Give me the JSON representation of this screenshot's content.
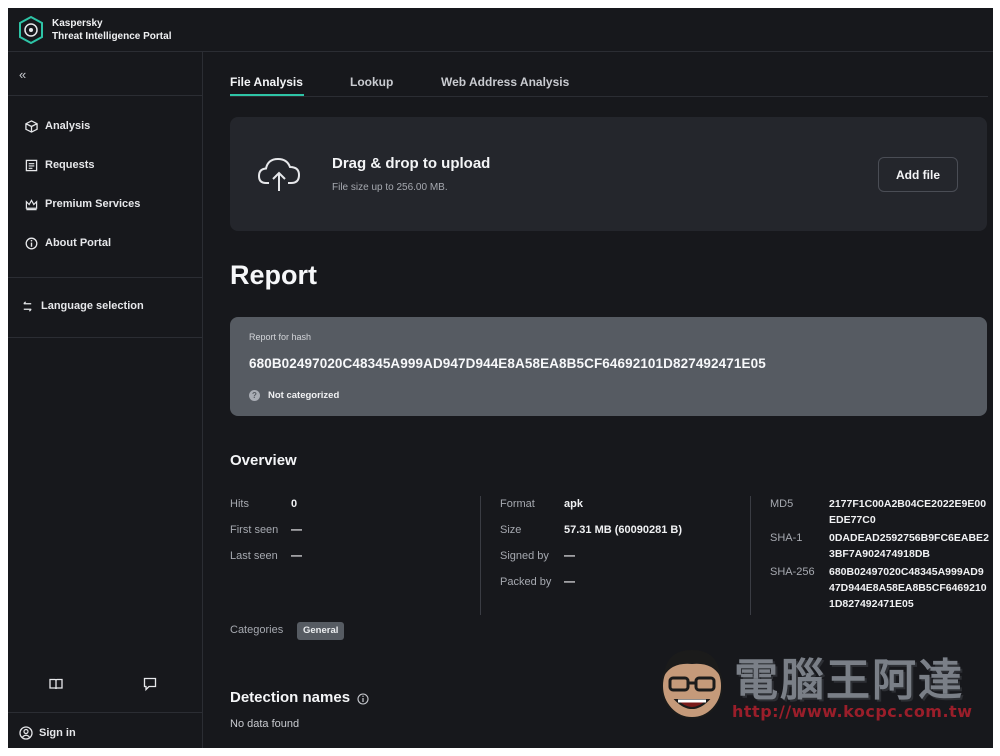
{
  "app": {
    "brand_line1": "Kaspersky",
    "brand_line2": "Threat Intelligence Portal"
  },
  "sidebar": {
    "collapse_label": "«",
    "items": [
      {
        "label": "Analysis",
        "icon": "cube-icon"
      },
      {
        "label": "Requests",
        "icon": "document-list-icon"
      },
      {
        "label": "Premium Services",
        "icon": "crown-icon"
      },
      {
        "label": "About Portal",
        "icon": "info-icon"
      }
    ],
    "language_label": "Language selection",
    "signin_label": "Sign in"
  },
  "tabs": [
    {
      "label": "File Analysis",
      "active": true
    },
    {
      "label": "Lookup",
      "active": false
    },
    {
      "label": "Web Address Analysis",
      "active": false
    }
  ],
  "upload": {
    "title": "Drag & drop to upload",
    "subtitle": "File size up to 256.00 MB.",
    "button_label": "Add file"
  },
  "report": {
    "heading": "Report",
    "hash_label": "Report for hash",
    "hash_value": "680B02497020C48345A999AD947D944E8A58EA8B5CF64692101D827492471E05",
    "status": "Not categorized"
  },
  "overview": {
    "heading": "Overview",
    "col1": [
      {
        "label": "Hits",
        "value": "0"
      },
      {
        "label": "First seen",
        "value": "—"
      },
      {
        "label": "Last seen",
        "value": "—"
      }
    ],
    "col2": [
      {
        "label": "Format",
        "value": "apk"
      },
      {
        "label": "Size",
        "value": "57.31 MB (60090281 B)"
      },
      {
        "label": "Signed by",
        "value": "—"
      },
      {
        "label": "Packed by",
        "value": "—"
      }
    ],
    "col3": [
      {
        "label": "MD5",
        "value": "2177F1C00A2B04CE2022E9E00EDE77C0"
      },
      {
        "label": "SHA-1",
        "value": "0DADEAD2592756B9FC6EABE23BF7A902474918DB"
      },
      {
        "label": "SHA-256",
        "value": "680B02497020C48345A999AD947D944E8A58EA8B5CF64692101D827492471E05"
      }
    ],
    "categories_label": "Categories",
    "category_badge": "General"
  },
  "detection": {
    "heading": "Detection names",
    "empty_text": "No data found"
  },
  "watermark": {
    "title": "電腦王阿達",
    "url": "http://www.kocpc.com.tw"
  },
  "colors": {
    "background": "#17181c",
    "panel": "#24262c",
    "hash_card": "#565b62",
    "accent": "#2ec4a6"
  }
}
